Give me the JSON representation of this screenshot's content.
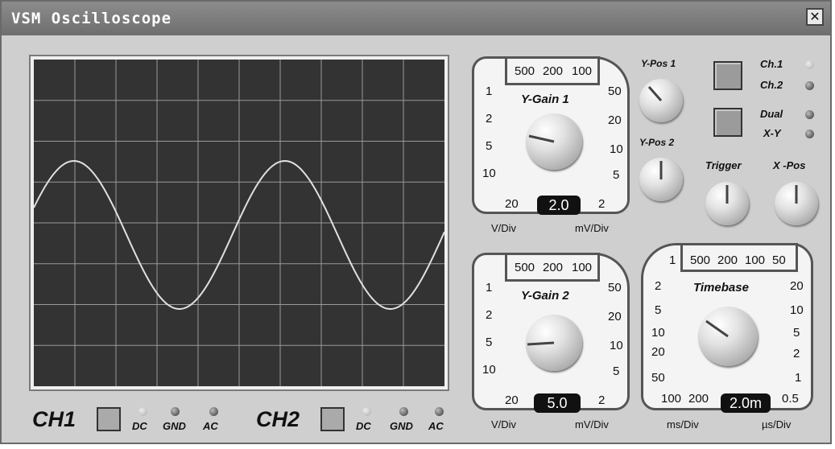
{
  "window": {
    "title": "VSM Oscilloscope",
    "close_glyph": "✕"
  },
  "scope": {
    "waveform": {
      "shape": "sine",
      "cycles_visible": 2.0,
      "color": "#e0e0e0",
      "grid_divisions": [
        10,
        8
      ]
    }
  },
  "gain1": {
    "top_values": [
      "500",
      "200",
      "100"
    ],
    "left_values": [
      "1",
      "2",
      "5",
      "10",
      "20"
    ],
    "right_values": [
      "50",
      "20",
      "10",
      "5",
      "2"
    ],
    "title": "Y-Gain 1",
    "display": "2.0",
    "unit_left": "V/Div",
    "unit_right": "mV/Div"
  },
  "gain2": {
    "top_values": [
      "500",
      "200",
      "100"
    ],
    "left_values": [
      "1",
      "2",
      "5",
      "10",
      "20"
    ],
    "right_values": [
      "50",
      "20",
      "10",
      "5",
      "2"
    ],
    "title": "Y-Gain 2",
    "display": "5.0",
    "unit_left": "V/Div",
    "unit_right": "mV/Div"
  },
  "timebase": {
    "top_values": [
      "1",
      "500",
      "200",
      "100",
      "50"
    ],
    "left_values": [
      "2",
      "5",
      "10",
      "20",
      "50",
      "100",
      "200"
    ],
    "right_values": [
      "20",
      "10",
      "5",
      "2",
      "1",
      "0.5"
    ],
    "title": "Timebase",
    "display": "2.0m",
    "unit_left": "ms/Div",
    "unit_right": "µs/Div"
  },
  "knobs": {
    "ypos1": "Y-Pos 1",
    "ypos2": "Y-Pos 2",
    "trigger": "Trigger",
    "xpos": "X -Pos"
  },
  "modes": {
    "ch1": "Ch.1",
    "ch2": "Ch.2",
    "dual": "Dual",
    "xy": "X-Y"
  },
  "channels": {
    "ch1": {
      "label": "CH1",
      "dc": "DC",
      "gnd": "GND",
      "ac": "AC"
    },
    "ch2": {
      "label": "CH2",
      "dc": "DC",
      "gnd": "GND",
      "ac": "AC"
    }
  }
}
